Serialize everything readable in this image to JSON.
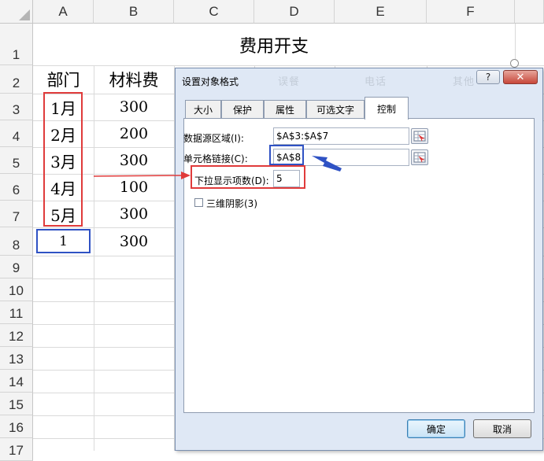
{
  "spreadsheet": {
    "columns": [
      "A",
      "B",
      "C",
      "D",
      "E",
      "F"
    ],
    "rows": [
      "1",
      "2",
      "3",
      "4",
      "5",
      "6",
      "7",
      "8",
      "9",
      "10",
      "11",
      "12",
      "13",
      "14",
      "15",
      "16",
      "17"
    ],
    "title": "费用开支",
    "header_department": "部门",
    "header_material": "材料费",
    "months": [
      "1月",
      "2月",
      "3月",
      "4月",
      "5月"
    ],
    "material_values": [
      "300",
      "200",
      "300",
      "100",
      "300",
      "300"
    ],
    "linked_cell_value": "1"
  },
  "dialog": {
    "title": "设置对象格式",
    "help_label": "?",
    "close_label": "✕",
    "tabs": [
      "大小",
      "保护",
      "属性",
      "可选文字",
      "控制"
    ],
    "active_tab": "控制",
    "source_range_label": "数据源区域(I):",
    "source_range_value": "$A$3:$A$7",
    "cell_link_label": "单元格链接(C):",
    "cell_link_value": "$A$8",
    "dropdown_lines_label": "下拉显示项数(D):",
    "dropdown_lines_value": "5",
    "shading_label": "三维阴影(3)",
    "ok_label": "确定",
    "cancel_label": "取消",
    "ghost_headers": [
      "误餐",
      "电话",
      "其他"
    ]
  },
  "colors": {
    "highlight_red": "#e03b3b",
    "highlight_blue": "#2f52c4",
    "dialog_bg": "#dfe8f5",
    "close_red": "#c7473a"
  },
  "icons": [
    "range-select-icon",
    "arrow-icon"
  ]
}
